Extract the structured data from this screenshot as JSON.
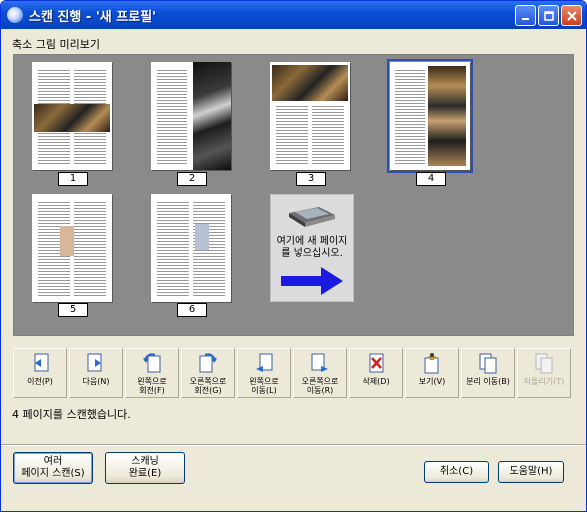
{
  "window": {
    "title": "스캔 진행 - '새 프로필'"
  },
  "section_label": "축소 그림 미리보기",
  "thumbnails": [
    {
      "number": "1",
      "selected": false
    },
    {
      "number": "2",
      "selected": false
    },
    {
      "number": "3",
      "selected": false
    },
    {
      "number": "4",
      "selected": true
    },
    {
      "number": "5",
      "selected": false
    },
    {
      "number": "6",
      "selected": false
    }
  ],
  "insert_card": {
    "line1": "여기에 새 페이지",
    "line2": "를 넣으십시오."
  },
  "toolbar": [
    {
      "label_line1": "이전(P)",
      "label_line2": "",
      "icon": "previous-page-icon",
      "enabled": true
    },
    {
      "label_line1": "다음(N)",
      "label_line2": "",
      "icon": "next-page-icon",
      "enabled": true
    },
    {
      "label_line1": "왼쪽으로",
      "label_line2": "회전(F)",
      "icon": "rotate-left-icon",
      "enabled": true
    },
    {
      "label_line1": "오른쪽으로",
      "label_line2": "회전(G)",
      "icon": "rotate-right-icon",
      "enabled": true
    },
    {
      "label_line1": "왼쪽으로",
      "label_line2": "이동(L)",
      "icon": "move-left-icon",
      "enabled": true
    },
    {
      "label_line1": "오른쪽으로",
      "label_line2": "이동(R)",
      "icon": "move-right-icon",
      "enabled": true
    },
    {
      "label_line1": "삭제(D)",
      "label_line2": "",
      "icon": "delete-icon",
      "enabled": true
    },
    {
      "label_line1": "보기(V)",
      "label_line2": "",
      "icon": "view-icon",
      "enabled": true
    },
    {
      "label_line1": "분리 이동(B)",
      "label_line2": "",
      "icon": "split-icon",
      "enabled": true
    },
    {
      "label_line1": "되돌리기(T)",
      "label_line2": "",
      "icon": "undo-icon",
      "enabled": false
    }
  ],
  "status": "4 페이지를 스캔했습니다.",
  "buttons": {
    "multi_line1": "여러",
    "multi_line2": "페이지 스캔(S)",
    "finish_line1": "스캐닝",
    "finish_line2": "완료(E)",
    "cancel": "취소(C)",
    "help": "도움말(H)"
  }
}
